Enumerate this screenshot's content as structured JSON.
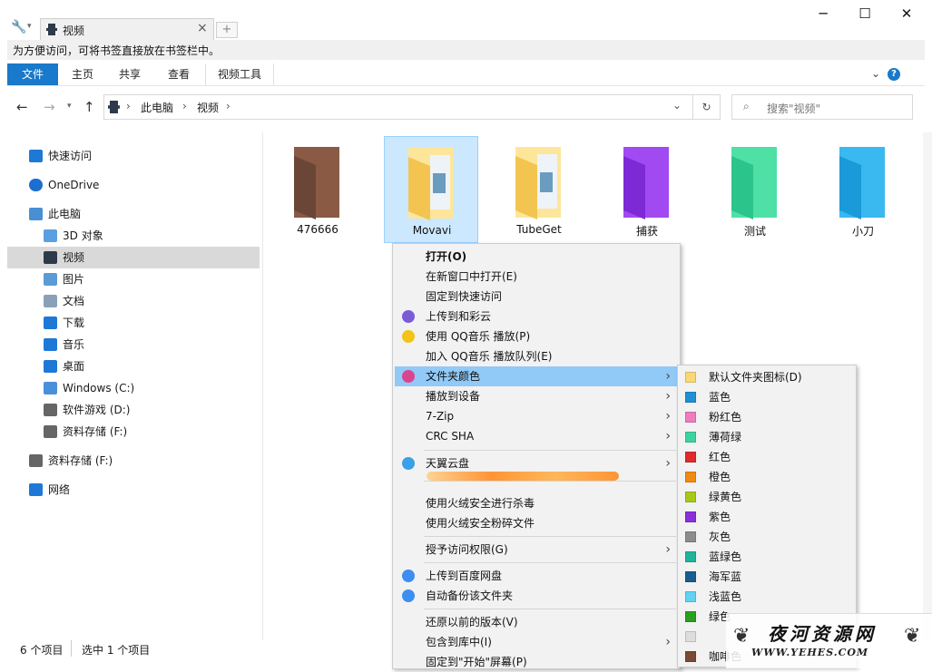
{
  "window": {
    "tab_title": "视频",
    "tab_close": "×",
    "new_tab": "+",
    "controls": {
      "minimize": "─",
      "maximize": "☐",
      "close": "✕"
    }
  },
  "bookmark_hint": "为方便访问，可将书签直接放在书签栏中。",
  "ribbon": {
    "tabs": [
      "文件",
      "主页",
      "共享",
      "查看",
      "视频工具"
    ],
    "expand": "⌄",
    "help": "?"
  },
  "address": {
    "back": "←",
    "forward": "→",
    "up": "↑",
    "crumbs": [
      "此电脑",
      "视频"
    ],
    "sep": "›",
    "dropdown": "⌄",
    "refresh": "↻",
    "search_placeholder": "搜索\"视频\""
  },
  "nav": [
    {
      "label": "快速访问",
      "icon": "star-icon",
      "color": "#1e78d6"
    },
    {
      "label": "OneDrive",
      "icon": "cloud-icon",
      "color": "#1c6fd0"
    },
    {
      "label": "此电脑",
      "icon": "computer-icon",
      "color": "#4a8fd4"
    },
    {
      "label": "3D 对象",
      "icon": "cube-icon",
      "color": "#5aa0e0"
    },
    {
      "label": "视频",
      "icon": "film-icon",
      "color": "#2d3a4a"
    },
    {
      "label": "图片",
      "icon": "pictures-icon",
      "color": "#5b9bd5"
    },
    {
      "label": "文档",
      "icon": "document-icon",
      "color": "#8aa0b8"
    },
    {
      "label": "下载",
      "icon": "download-icon",
      "color": "#1e78d6"
    },
    {
      "label": "音乐",
      "icon": "music-icon",
      "color": "#1e78d6"
    },
    {
      "label": "桌面",
      "icon": "desktop-icon",
      "color": "#1e78d6"
    },
    {
      "label": "Windows (C:)",
      "icon": "drive-windows-icon",
      "color": "#4a90d9"
    },
    {
      "label": "软件游戏 (D:)",
      "icon": "drive-icon",
      "color": "#666666"
    },
    {
      "label": "资料存储 (F:)",
      "icon": "drive-icon",
      "color": "#666666"
    },
    {
      "label": "资料存储 (F:)",
      "icon": "drive-icon",
      "color": "#666666"
    },
    {
      "label": "网络",
      "icon": "network-icon",
      "color": "#1e78d6"
    }
  ],
  "folders": [
    {
      "label": "476666",
      "color": "#6b4636",
      "color2": "#8a5a45"
    },
    {
      "label": "Movavi",
      "color": "#f3c550",
      "color2": "#fde69a"
    },
    {
      "label": "TubeGet",
      "color": "#f3c550",
      "color2": "#fde69a"
    },
    {
      "label": "捕获",
      "color": "#7d2ad6",
      "color2": "#a24af2"
    },
    {
      "label": "测试",
      "color": "#2bc48a",
      "color2": "#4fe0a6"
    },
    {
      "label": "小刀",
      "color": "#1a9ad8",
      "color2": "#3ab8f0"
    }
  ],
  "status": {
    "count": "6 个项目",
    "selected": "选中 1 个项目"
  },
  "context_menu": [
    {
      "label": "打开(O)",
      "bold": true
    },
    {
      "label": "在新窗口中打开(E)"
    },
    {
      "label": "固定到快速访问"
    },
    {
      "label": "上传到和彩云",
      "icon": "caiyun-icon",
      "icon_color": "#7a5cd6"
    },
    {
      "label": "使用 QQ音乐 播放(P)",
      "icon": "qqmusic-icon",
      "icon_color": "#f2c318"
    },
    {
      "label": "加入 QQ音乐 播放队列(E)"
    },
    {
      "label": "文件夹颜色",
      "icon": "paintbrush-icon",
      "icon_color": "#d9458f",
      "submenu": true,
      "highlight": true
    },
    {
      "label": "播放到设备",
      "submenu": true
    },
    {
      "label": "7-Zip",
      "submenu": true
    },
    {
      "label": "CRC SHA",
      "submenu": true
    },
    {
      "label": "天翼云盘",
      "icon": "tianyi-cloud-icon",
      "icon_color": "#3aa0e8",
      "submenu": true
    },
    {
      "label": "使用火绒安全进行杀毒"
    },
    {
      "label": "使用火绒安全粉碎文件"
    },
    {
      "label": "授予访问权限(G)",
      "submenu": true
    },
    {
      "label": "上传到百度网盘",
      "icon": "baidu-icon",
      "icon_color": "#3c8ef0"
    },
    {
      "label": "自动备份该文件夹",
      "icon": "baidu-icon",
      "icon_color": "#3c8ef0"
    },
    {
      "label": "还原以前的版本(V)"
    },
    {
      "label": "包含到库中(I)",
      "submenu": true
    },
    {
      "label": "固定到\"开始\"屏幕(P)"
    }
  ],
  "color_submenu": [
    {
      "label": "默认文件夹图标(D)",
      "color": "#f8d775"
    },
    {
      "label": "蓝色",
      "color": "#1e90d6"
    },
    {
      "label": "粉红色",
      "color": "#f07cc0"
    },
    {
      "label": "薄荷绿",
      "color": "#3dd3a0"
    },
    {
      "label": "红色",
      "color": "#e02b2b"
    },
    {
      "label": "橙色",
      "color": "#f08a12"
    },
    {
      "label": "绿黄色",
      "color": "#a8c818"
    },
    {
      "label": "紫色",
      "color": "#8a30d8"
    },
    {
      "label": "灰色",
      "color": "#8c8c8c"
    },
    {
      "label": "蓝绿色",
      "color": "#1fb39a"
    },
    {
      "label": "海军蓝",
      "color": "#1a5c8f"
    },
    {
      "label": "浅蓝色",
      "color": "#5fd3f0"
    },
    {
      "label": "绿色",
      "color": "#2aa01e"
    },
    {
      "label": "",
      "color": "#dddddd"
    },
    {
      "label": "咖啡色",
      "color": "#7a4a32"
    }
  ],
  "watermark": {
    "title": "夜河资源网",
    "url": "WWW.YEHES.COM"
  }
}
